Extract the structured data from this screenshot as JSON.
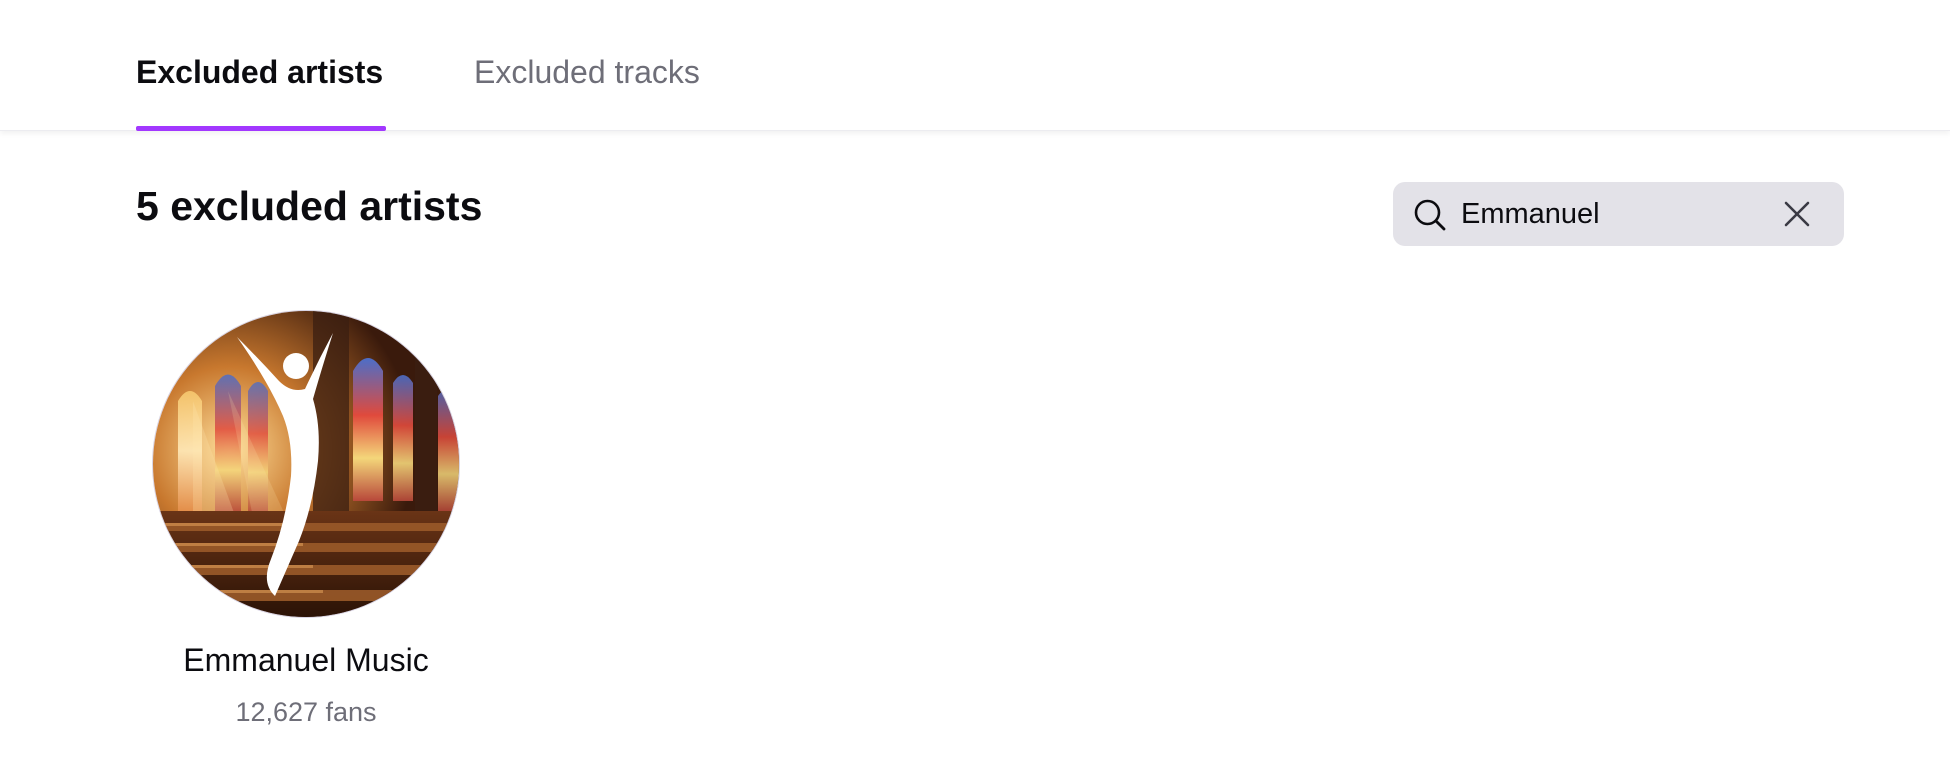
{
  "tabs": [
    {
      "label": "Excluded artists",
      "active": true
    },
    {
      "label": "Excluded tracks",
      "active": false
    }
  ],
  "accent_color": "#a238ff",
  "header": {
    "title": "5 excluded artists"
  },
  "search": {
    "value": "Emmanuel",
    "icon": "search-icon",
    "clear_icon": "close-icon"
  },
  "artists": [
    {
      "name": "Emmanuel Music",
      "fans": "12,627 fans",
      "avatar": "church-interior-with-stained-glass-and-dancer-silhouette"
    }
  ]
}
